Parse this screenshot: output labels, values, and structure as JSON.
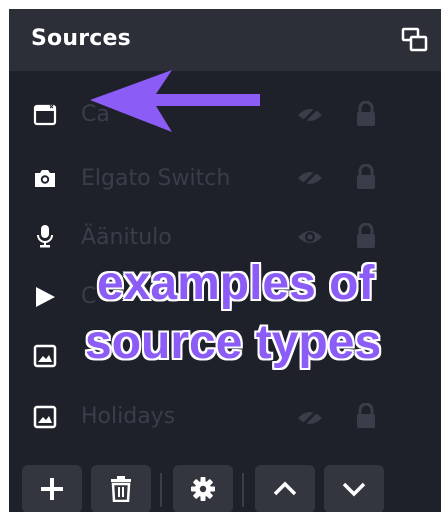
{
  "panel": {
    "title": "Sources",
    "dock_icon": "undock-icon"
  },
  "sources": [
    {
      "name": "Ca",
      "type_icon": "window-capture-icon",
      "visibility_icon": "eye-off-icon",
      "lock_icon": "lock-icon"
    },
    {
      "name": "Elgato Switch",
      "type_icon": "camera-icon",
      "visibility_icon": "eye-off-icon",
      "lock_icon": "lock-icon"
    },
    {
      "name": "Äänitulo",
      "type_icon": "microphone-icon",
      "visibility_icon": "eye-icon",
      "lock_icon": "lock-icon"
    },
    {
      "name": "C",
      "type_icon": "media-play-icon",
      "visibility_icon": "eye-icon",
      "lock_icon": "lock-icon"
    },
    {
      "name": "",
      "type_icon": "image-icon",
      "visibility_icon": "eye-icon",
      "lock_icon": "lock-icon"
    },
    {
      "name": "Holidays",
      "type_icon": "image-icon",
      "visibility_icon": "eye-off-icon",
      "lock_icon": "lock-icon"
    }
  ],
  "toolbar": {
    "buttons": [
      "add-icon",
      "trash-icon",
      "gear-icon",
      "chevron-up-icon",
      "chevron-down-icon"
    ]
  },
  "annotation": {
    "line1": "examples of",
    "line2": "source types",
    "arrow_color": "#8b5cf6"
  },
  "colors": {
    "panel_bg": "#1f212a",
    "header_bg": "#2c2e38",
    "button_bg": "#33363f",
    "dim_text": "#3a3d4a",
    "accent": "#8b5cf6"
  }
}
